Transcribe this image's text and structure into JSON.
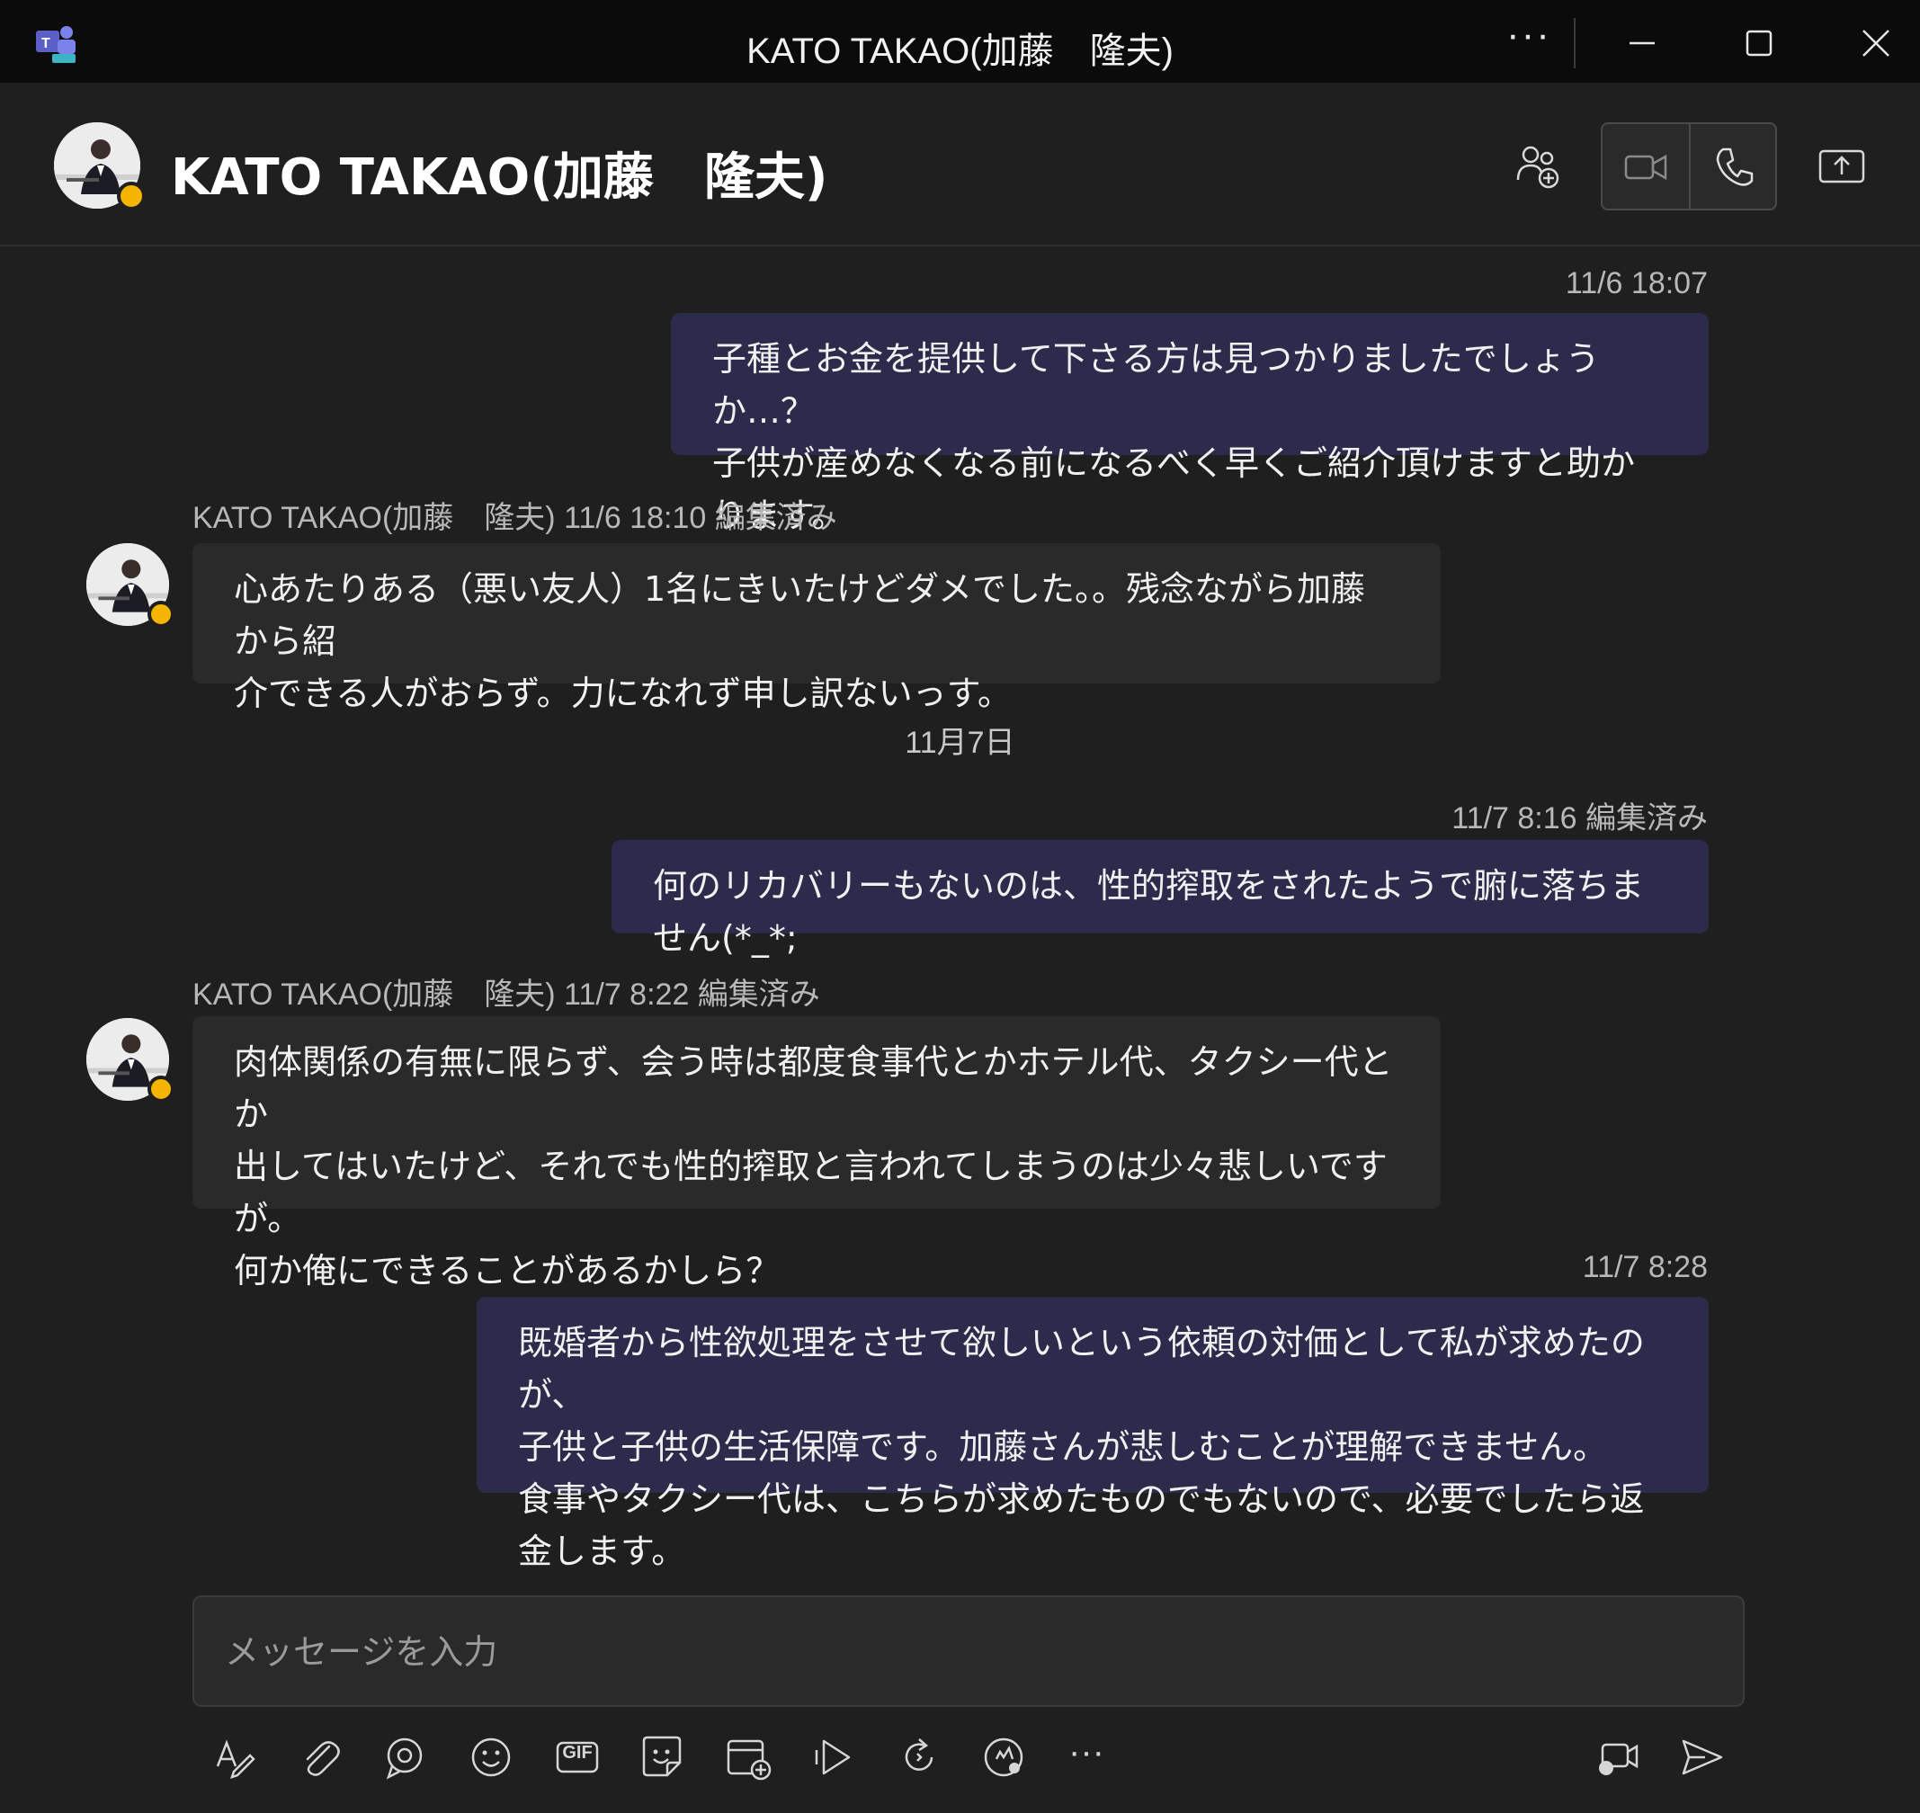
{
  "window": {
    "title": "KATO TAKAO(加藤　隆夫)",
    "more_label": "···"
  },
  "header": {
    "name": "KATO TAKAO(加藤　隆夫)"
  },
  "messages": [
    {
      "direction": "outgoing",
      "meta": "11/6 18:07",
      "text": "子種とお金を提供して下さる方は見つかりましたでしょうか…？\n子供が産めなくなる前になるべく早くご紹介頂けますと助かります。"
    },
    {
      "direction": "incoming",
      "meta": "KATO TAKAO(加藤　隆夫)  11/6 18:10   編集済み",
      "text": "心あたりある（悪い友人）1名にきいたけどダメでした。。残念ながら加藤から紹\n介できる人がおらず。力になれず申し訳ないっす。"
    },
    {
      "direction": "outgoing",
      "meta": "11/7 8:16   編集済み",
      "text": "何のリカバリーもないのは、性的搾取をされたようで腑に落ちません(*_*;"
    },
    {
      "direction": "incoming",
      "meta": "KATO TAKAO(加藤　隆夫)  11/7 8:22   編集済み",
      "text": "肉体関係の有無に限らず、会う時は都度食事代とかホテル代、タクシー代とか\n出してはいたけど、それでも性的搾取と言われてしまうのは少々悲しいですが。\n何か俺にできることがあるかしら？"
    },
    {
      "direction": "outgoing",
      "meta": "11/7 8:28",
      "text": "既婚者から性欲処理をさせて欲しいという依頼の対価として私が求めたのが、\n子供と子供の生活保障です。加藤さんが悲しむことが理解できません。\n食事やタクシー代は、こちらが求めたものでもないので、必要でしたら返金します。"
    }
  ],
  "date_divider": "11月7日",
  "compose": {
    "placeholder": "メッセージを入力"
  },
  "toolbar": {
    "gif_label": "GIF",
    "more_label": "···"
  },
  "colors": {
    "background": "#1f1f1f",
    "titlebar": "#0b0b0b",
    "bubble_mine": "#2c2b4b",
    "bubble_theirs": "#2a2a2a",
    "status_away": "#f4b400"
  }
}
